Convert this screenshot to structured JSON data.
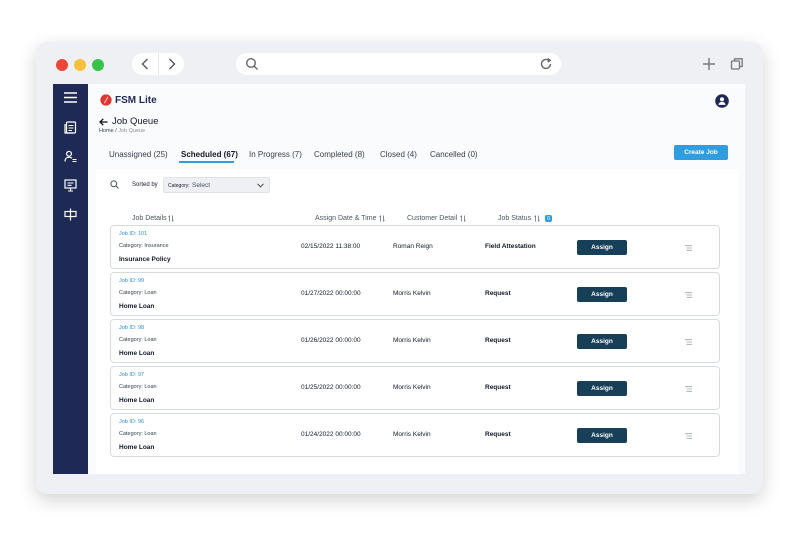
{
  "colors": {
    "sidebar": "#1e2a55",
    "accent": "#2f9de0",
    "assign_button": "#173f57",
    "brand_red": "#e3342f",
    "link_blue": "#2b8fd6"
  },
  "brand": {
    "name": "FSM Lite"
  },
  "page": {
    "title": "Job Queue",
    "breadcrumb_home": "Home",
    "breadcrumb_sep": "/",
    "breadcrumb_current": "Job Queue"
  },
  "tabs": [
    {
      "label": "Unassigned (25)"
    },
    {
      "label": "Scheduled (67)"
    },
    {
      "label": "In Progress (7)"
    },
    {
      "label": "Completed (8)"
    },
    {
      "label": "Closed (4)"
    },
    {
      "label": "Cancelled (0)"
    }
  ],
  "create_job_label": "Create Job",
  "sort": {
    "label": "Sorted by",
    "field_label": "Category:",
    "placeholder": "Select"
  },
  "columns": {
    "job_details": "Job Details",
    "assign_date": "Assign Date & Time",
    "customer": "Customer Detail",
    "status": "Job Status",
    "status_badge": "0"
  },
  "jobs": [
    {
      "id": "Job ID: 101",
      "category": "Category: Insurance",
      "name": "Insurance Policy",
      "date": "02/15/2022 11:38:00",
      "customer": "Roman Reign",
      "status": "Field Attestation",
      "action": "Assign"
    },
    {
      "id": "Job ID: 99",
      "category": "Category: Loan",
      "name": "Home Loan",
      "date": "01/27/2022 00:00:00",
      "customer": "Morris Kelvin",
      "status": "Request",
      "action": "Assign"
    },
    {
      "id": "Job ID: 98",
      "category": "Category: Loan",
      "name": "Home Loan",
      "date": "01/26/2022 00:00:00",
      "customer": "Morris Kelvin",
      "status": "Request",
      "action": "Assign"
    },
    {
      "id": "Job ID: 97",
      "category": "Category: Loan",
      "name": "Home Loan",
      "date": "01/25/2022 00:00:00",
      "customer": "Morris Kelvin",
      "status": "Request",
      "action": "Assign"
    },
    {
      "id": "Job ID: 96",
      "category": "Category: Loan",
      "name": "Home Loan",
      "date": "01/24/2022 00:00:00",
      "customer": "Morris Kelvin",
      "status": "Request",
      "action": "Assign"
    }
  ]
}
